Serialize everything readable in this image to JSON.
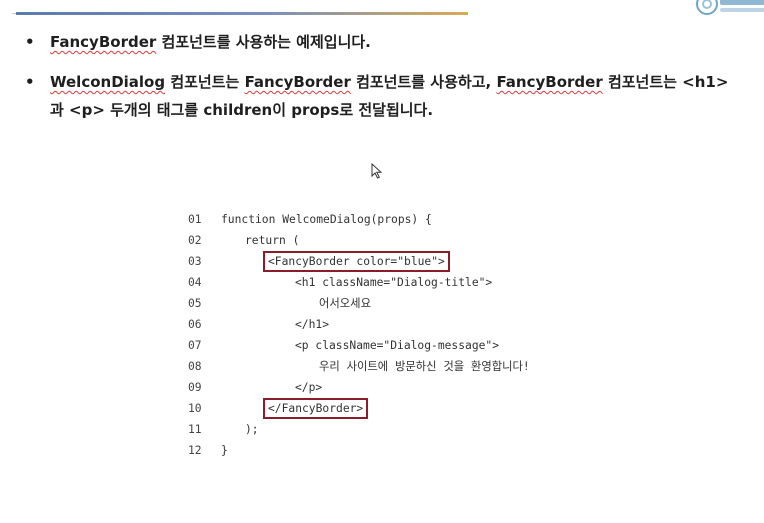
{
  "bullets": [
    {
      "text_before": "",
      "squiggle": "FancyBorder",
      "text_after": " 컴포넌트를 사용하는 예제입니다."
    },
    {
      "line1_seg1": "WelconDialog",
      "line1_seg2": " 컴포넌트는 ",
      "line1_seg3": "FancyBorder",
      "line1_seg4": " 컴포넌트를 사용하고, ",
      "line1_seg5": "FancyBorder",
      "line1_seg6": " 컴포넌트는 <h1>",
      "line2": "과 <p> 두개의 태그를 children이 props로 전달됩니다."
    }
  ],
  "bullet_symbol": "•",
  "code": [
    {
      "ln": "01",
      "text": "function WelcomeDialog(props) {"
    },
    {
      "ln": "02",
      "text": "return ("
    },
    {
      "ln": "03",
      "text": "<FancyBorder color=\"blue\">"
    },
    {
      "ln": "04",
      "text": "<h1 className=\"Dialog-title\">"
    },
    {
      "ln": "05",
      "text": "어서오세요"
    },
    {
      "ln": "06",
      "text": "</h1>"
    },
    {
      "ln": "07",
      "text": "<p className=\"Dialog-message\">"
    },
    {
      "ln": "08",
      "text": "우리 사이트에 방문하신 것을 환영합니다!"
    },
    {
      "ln": "09",
      "text": "</p>"
    },
    {
      "ln": "10",
      "text": "</FancyBorder>"
    },
    {
      "ln": "11",
      "text": ");"
    },
    {
      "ln": "12",
      "text": "}"
    }
  ],
  "colors": {
    "highlight_box": "#8a1c2b",
    "spell_underline": "#d23c3c",
    "text": "#1f1f1f"
  },
  "icons": {
    "cursor": "mouse-pointer-icon",
    "logo": "university-logo-icon"
  }
}
